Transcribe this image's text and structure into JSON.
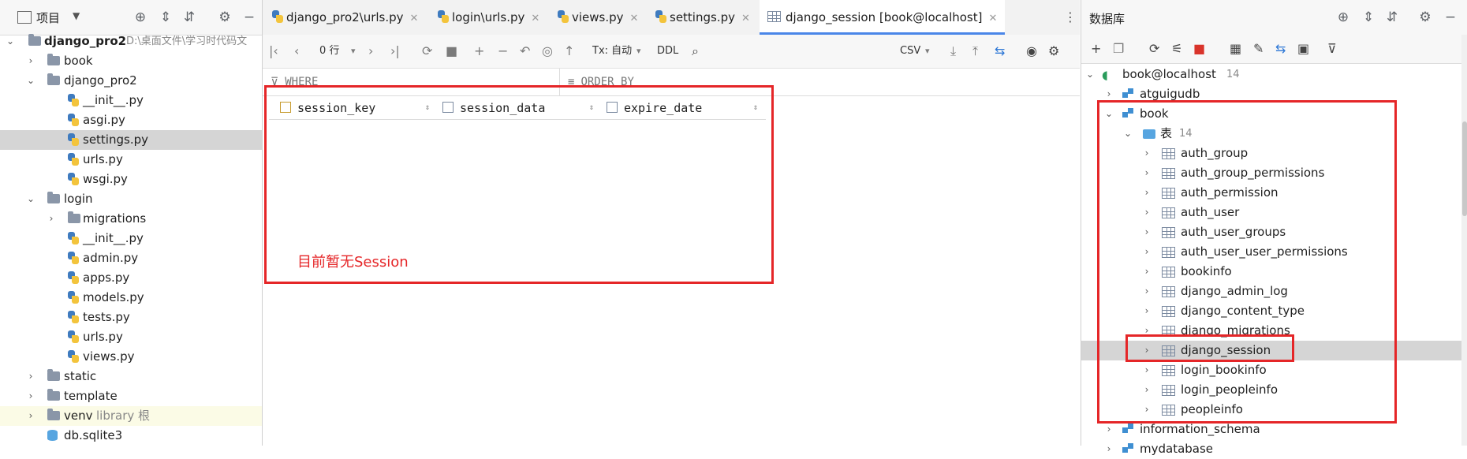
{
  "project_panel": {
    "title": "项目",
    "tree": [
      {
        "label": "django_pro2",
        "hint": "D:\\桌面文件\\学习时代码文",
        "kind": "folder",
        "bold": true
      },
      {
        "label": "book",
        "kind": "folder"
      },
      {
        "label": "django_pro2",
        "kind": "folder"
      },
      {
        "label": "__init__.py",
        "kind": "py"
      },
      {
        "label": "asgi.py",
        "kind": "py"
      },
      {
        "label": "settings.py",
        "kind": "py"
      },
      {
        "label": "urls.py",
        "kind": "py"
      },
      {
        "label": "wsgi.py",
        "kind": "py"
      },
      {
        "label": "login",
        "kind": "folder"
      },
      {
        "label": "migrations",
        "kind": "folder"
      },
      {
        "label": "__init__.py",
        "kind": "py"
      },
      {
        "label": "admin.py",
        "kind": "py"
      },
      {
        "label": "apps.py",
        "kind": "py"
      },
      {
        "label": "models.py",
        "kind": "py"
      },
      {
        "label": "tests.py",
        "kind": "py"
      },
      {
        "label": "urls.py",
        "kind": "py"
      },
      {
        "label": "views.py",
        "kind": "py"
      },
      {
        "label": "static",
        "kind": "folder"
      },
      {
        "label": "template",
        "kind": "folder"
      },
      {
        "label": "venv",
        "hint": "library 根",
        "kind": "folder"
      },
      {
        "label": "db.sqlite3",
        "kind": "db"
      }
    ]
  },
  "editor": {
    "tabs": [
      {
        "label": "django_pro2\\urls.py"
      },
      {
        "label": "login\\urls.py"
      },
      {
        "label": "views.py"
      },
      {
        "label": "settings.py"
      },
      {
        "label": "django_session [book@localhost]"
      }
    ],
    "toolbar": {
      "rows_label": "0 行",
      "tx_label": "Tx: 自动",
      "ddl_label": "DDL",
      "export_label": "CSV"
    },
    "where_label": "WHERE",
    "order_by_label": "ORDER BY",
    "columns": [
      "session_key",
      "session_data",
      "expire_date"
    ],
    "annotation": "目前暂无Session",
    "annotation_color": "#e52628"
  },
  "db_panel": {
    "title": "数据库",
    "datasource": {
      "label": "book@localhost",
      "count": "14"
    },
    "schemas_top": [
      "atguigudb",
      "book"
    ],
    "tables_folder": {
      "label": "表",
      "count": "14"
    },
    "tables": [
      "auth_group",
      "auth_group_permissions",
      "auth_permission",
      "auth_user",
      "auth_user_groups",
      "auth_user_user_permissions",
      "bookinfo",
      "django_admin_log",
      "django_content_type",
      "django_migrations",
      "django_session",
      "login_bookinfo",
      "login_peopleinfo",
      "peopleinfo"
    ],
    "selected_table": "django_session",
    "schemas_bottom": [
      "information_schema",
      "mydatabase"
    ]
  }
}
